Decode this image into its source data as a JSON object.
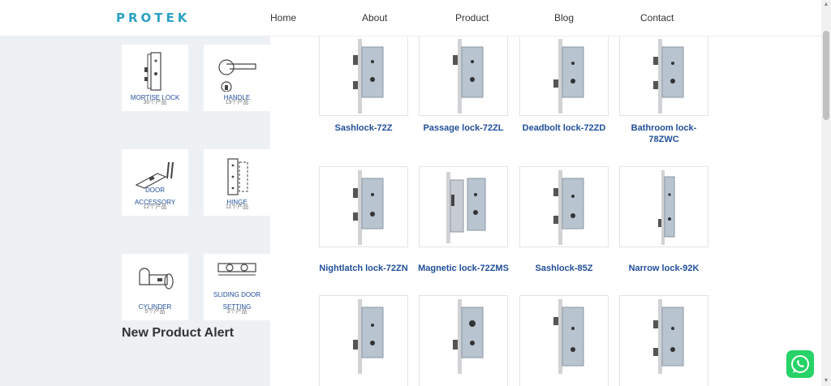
{
  "header": {
    "logo": "PROTEK",
    "nav": [
      "Home",
      "About",
      "Product",
      "Blog",
      "Contact"
    ]
  },
  "sidebar": {
    "categories": [
      {
        "label": "MORTISE LOCK",
        "count": "30个产品"
      },
      {
        "label": "HANDLE",
        "count": "19个产品"
      },
      {
        "label": "DOOR",
        "label2": "ACCESSORY",
        "count": "12个产品"
      },
      {
        "label": "HINGE",
        "count": "11个产品"
      },
      {
        "label": "CYLINDER",
        "count": "5个产品"
      },
      {
        "label": "SLIDING DOOR",
        "label2": "SETTING",
        "count": "3个产品"
      }
    ],
    "alert_title": "New Product Alert"
  },
  "products": [
    {
      "name": "Sashlock-72Z"
    },
    {
      "name": "Passage lock-72ZL"
    },
    {
      "name": "Deadbolt lock-72ZD"
    },
    {
      "name": "Bathroom lock-",
      "name2": "78ZWC"
    },
    {
      "name": "Nightlatch lock-72ZN"
    },
    {
      "name": "Magnetic lock-72ZMS"
    },
    {
      "name": "Sashlock-85Z"
    },
    {
      "name": "Narrow lock-92K"
    },
    {
      "name": ""
    },
    {
      "name": ""
    },
    {
      "name": ""
    },
    {
      "name": ""
    }
  ],
  "colors": {
    "brand": "#2aa1c4",
    "link": "#1f4e9b",
    "sidebar_bg": "#eef1f4",
    "whatsapp": "#25d366"
  }
}
